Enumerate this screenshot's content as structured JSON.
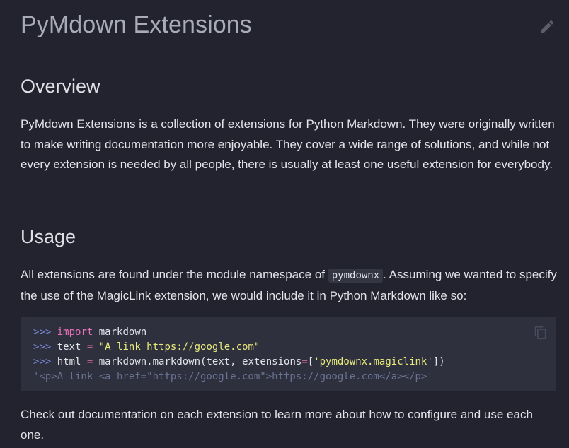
{
  "page": {
    "title": "PyMdown Extensions",
    "edit_icon": "pencil-icon"
  },
  "overview": {
    "heading": "Overview",
    "text": "PyMdown Extensions is a collection of extensions for Python Markdown. They were originally written to make writing documentation more enjoyable. They cover a wide range of solutions, and while not every extension is needed by all people, there is usually at least one useful extension for everybody."
  },
  "usage": {
    "heading": "Usage",
    "text_before": "All extensions are found under the module namespace of ",
    "inline_code": "pymdownx",
    "text_after": ". Assuming we wanted to specify the use of the MagicLink extension, we would include it in Python Markdown like so:"
  },
  "code": {
    "copy_icon": "copy-icon",
    "prompt": ">>>",
    "line1": {
      "kw": "import",
      "rest": " markdown"
    },
    "line2": {
      "name": " text ",
      "op": "=",
      "str": "\"A link https://google.com\""
    },
    "line3": {
      "name": " html ",
      "op": "=",
      "call": " markdown.markdown(text, extensions",
      "op2": "=",
      "open": "[",
      "str": "'pymdownx.magiclink'",
      "close": "])"
    },
    "output": "'<p>A link <a href=\"https://google.com\">https://google.com</a></p>'"
  },
  "closing": {
    "text": "Check out documentation on each extension to learn more about how to configure and use each one."
  },
  "colors": {
    "background": "#22232e",
    "code_background": "#2e303e",
    "keyword": "#e772b5",
    "string": "#e9ea7c",
    "prompt": "#7a8ad6",
    "output": "#6c7293"
  }
}
